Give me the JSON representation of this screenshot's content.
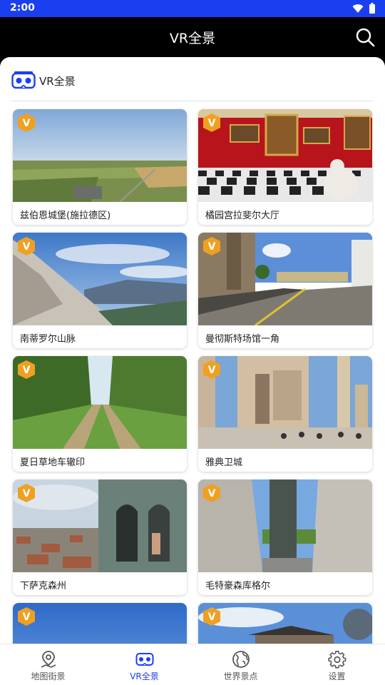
{
  "status_bar": {
    "time": "2:00"
  },
  "header": {
    "title": "VR全景"
  },
  "section": {
    "label": "VR全景"
  },
  "cards": [
    {
      "title": "兹伯恩城堡(施拉德区)"
    },
    {
      "title": "橘园宫拉斐尔大厅"
    },
    {
      "title": "南蒂罗尔山脉"
    },
    {
      "title": "曼彻斯特场馆一角"
    },
    {
      "title": "夏日草地车辙印"
    },
    {
      "title": "雅典卫城"
    },
    {
      "title": "下萨克森州"
    },
    {
      "title": "毛特豪森库格尔"
    },
    {
      "title": ""
    },
    {
      "title": ""
    }
  ],
  "nav": {
    "items": [
      {
        "label": "地图街景",
        "icon": "map-pin-icon"
      },
      {
        "label": "VR全景",
        "icon": "vr-headset-icon",
        "active": true
      },
      {
        "label": "世界景点",
        "icon": "globe-icon"
      },
      {
        "label": "设置",
        "icon": "gear-icon"
      }
    ]
  },
  "colors": {
    "accent": "#1a3ff0",
    "badge": "#f0a020",
    "header_bg": "#000000"
  }
}
